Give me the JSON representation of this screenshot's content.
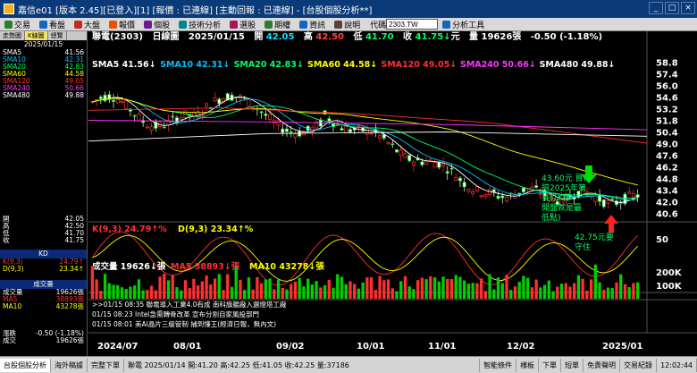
{
  "window": {
    "title": "嘉信e01 [版本 2.45][已登入][1] [報價 : 已連線] [主動回報 : 已連線] - [台股個股分析**]"
  },
  "toolbar": {
    "items": [
      {
        "label": "交易",
        "color": "#2e7d32"
      },
      {
        "label": "看盤",
        "color": "#1565c0"
      },
      {
        "label": "大盤",
        "color": "#c62828"
      },
      {
        "label": "報價",
        "color": "#e65100"
      },
      {
        "label": "個股",
        "color": "#6a1b9a"
      },
      {
        "label": "技術分析",
        "color": "#00838f"
      },
      {
        "label": "選股",
        "color": "#ad1457"
      },
      {
        "label": "期權",
        "color": "#2e7d32"
      },
      {
        "label": "資訊",
        "color": "#1565c0"
      },
      {
        "label": "說明",
        "color": "#5d4037"
      }
    ],
    "symbol_label": "代碼",
    "symbol_value": "2303.TW",
    "analysis_label": "分析工具"
  },
  "left_panel": {
    "tabs": [
      "走勢圖",
      "K線圖",
      "總覽"
    ],
    "date": "2025/01/15",
    "ma_rows": [
      {
        "name": "SMA5",
        "value": "41.56",
        "color": "#ffffff"
      },
      {
        "name": "SMA10",
        "value": "42.31",
        "color": "#00c0ff"
      },
      {
        "name": "SMA20",
        "value": "42.83",
        "color": "#00ff66"
      },
      {
        "name": "SMA60",
        "value": "44.58",
        "color": "#ffff00"
      },
      {
        "name": "SMA120",
        "value": "49.05",
        "color": "#ff3030"
      },
      {
        "name": "SMA240",
        "value": "50.66",
        "color": "#ff33ff"
      },
      {
        "name": "SMA480",
        "value": "49.88",
        "color": "#ffffff"
      }
    ],
    "ohlc_rows": [
      {
        "name": "開",
        "value": "42.05"
      },
      {
        "name": "高",
        "value": "42.50"
      },
      {
        "name": "低",
        "value": "41.70"
      },
      {
        "name": "收",
        "value": "41.75"
      }
    ],
    "kd_header": "KD",
    "kd_rows": [
      {
        "name": "K(9,3)",
        "value": "24.79↑",
        "color": "#ff3030"
      },
      {
        "name": "D(9,3)",
        "value": "23.34↑",
        "color": "#ffff00"
      }
    ],
    "vol_header": "成交量",
    "vol_rows": [
      {
        "name": "成交量",
        "value": "19626張",
        "color": "#ffffff"
      },
      {
        "name": "MA5",
        "value": "38893張",
        "color": "#ff3030"
      },
      {
        "name": "MA10",
        "value": "43278張",
        "color": "#ffff00"
      }
    ],
    "change_rows": [
      {
        "name": "漲跌",
        "value": "-0.50 (-1.18%)"
      },
      {
        "name": "成交",
        "value": "19626張"
      }
    ]
  },
  "chart": {
    "stock": "聯電(2303)",
    "period": "日線圖",
    "date": "2025/01/15",
    "open_label": "開",
    "open": "42.05",
    "high_label": "高",
    "high": "42.50",
    "low_label": "低",
    "low": "41.70",
    "close_label": "收",
    "close": "41.75",
    "close_arrow": "↓",
    "unit": "元",
    "volume_label": "量",
    "volume": "19626",
    "volume_unit": "張",
    "change": "-0.50",
    "change_pct": "(-1.18%)",
    "ma_legend": [
      {
        "text": "SMA5 41.56↓",
        "color": "#ffffff"
      },
      {
        "text": "SMA10 42.31↓",
        "color": "#00c0ff"
      },
      {
        "text": "SMA20 42.83↓",
        "color": "#00ff66"
      },
      {
        "text": "SMA60 44.58↓",
        "color": "#ffff00"
      },
      {
        "text": "SMA120 49.05↓",
        "color": "#ff3030"
      },
      {
        "text": "SMA240 50.66↓",
        "color": "#ff33ff"
      },
      {
        "text": "SMA480 49.88↓",
        "color": "#ffffff"
      }
    ],
    "price_ticks": [
      "58.8",
      "57.4",
      "56.0",
      "54.6",
      "53.2",
      "51.8",
      "50.4",
      "49.0",
      "47.6",
      "46.2",
      "44.8",
      "43.4",
      "42.0",
      "40.6"
    ],
    "annotation1_lines": [
      "43.60元 買(",
      "賠2025年第",
      "長紅K棒一",
      "開盤就是最",
      "低點)"
    ],
    "annotation2_lines": [
      "42.75元要",
      "守住"
    ],
    "kd_legend": [
      {
        "text": "K(9,3) 24.79↑%",
        "color": "#ff3030"
      },
      {
        "text": "D(9,3) 23.34↑%",
        "color": "#ffff00"
      }
    ],
    "kd_tick": "50",
    "vol_legend": [
      {
        "text": "成交量 19626↓張",
        "color": "#ffffff"
      },
      {
        "text": "MA5 38893↓張",
        "color": "#ff3030"
      },
      {
        "text": "MA10 43278↓張",
        "color": "#ffff00"
      }
    ],
    "vol_ticks": [
      "200K",
      "100K"
    ],
    "x_ticks": [
      "2024/07",
      "08/01",
      "09/02",
      "10/01",
      "11/01",
      "12/02",
      "2025/01"
    ],
    "news": [
      {
        "text": ">>01/15 08:35   聯電導入工業4.0有成 南科旗艦廠入選燈塔工廠"
      },
      {
        "text": "   01/15 08:23   Intel急需轉骨改革 宣布分割自家風投部門"
      },
      {
        "text": "   01/15 08:01   美AI晶片三級管制 捕到懂王(經濟日報，無內文)"
      }
    ]
  },
  "status": {
    "items": [
      "台股個股分析",
      "海外稿據",
      "完整下單"
    ],
    "quote": "聯電 2025/01/14 開:41.20 高:42.25 低:41.05 收:42.25 量:37186",
    "right_items": [
      "智能條件",
      "樣板",
      "下單",
      "短單",
      "免責聲明",
      "交易紀錄",
      "12:02:44"
    ]
  }
}
